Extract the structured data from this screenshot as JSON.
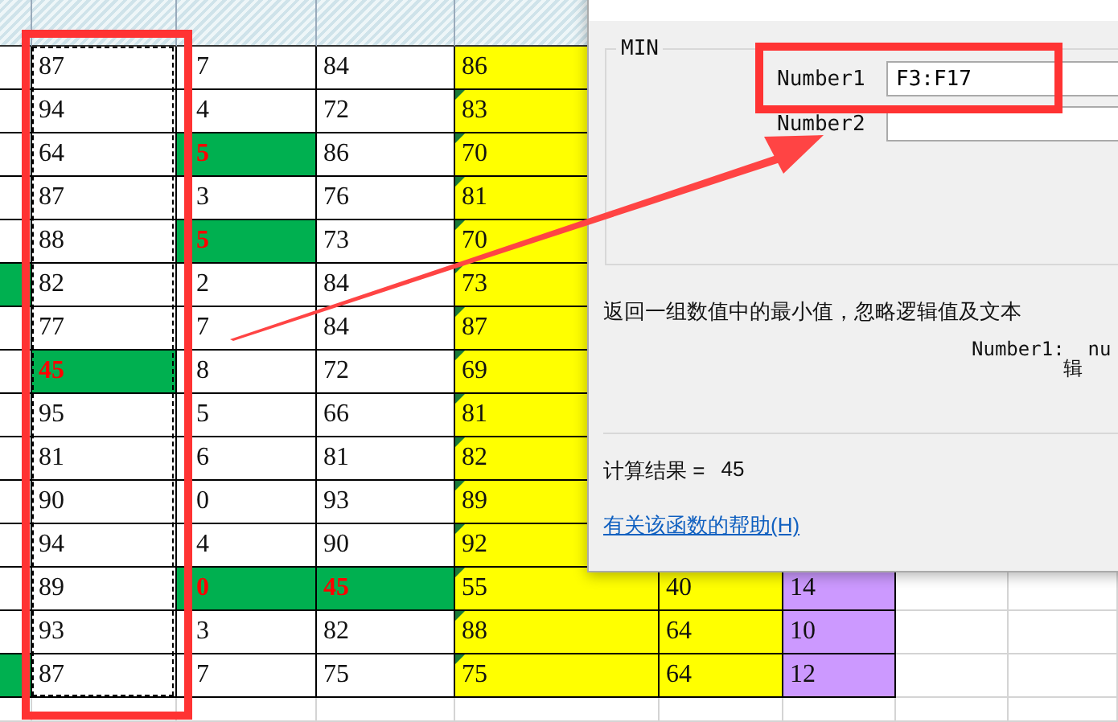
{
  "sheet": {
    "rows": [
      {
        "edge_highlight": false,
        "cells": [
          {
            "text": "87",
            "highlight": false
          },
          {
            "text": "7",
            "highlight": false
          },
          {
            "text": "84",
            "highlight": false
          },
          {
            "text": "86",
            "highlight": false,
            "flag": false
          }
        ]
      },
      {
        "edge_highlight": false,
        "cells": [
          {
            "text": "94",
            "highlight": false
          },
          {
            "text": "4",
            "highlight": false
          },
          {
            "text": "72",
            "highlight": false
          },
          {
            "text": "83",
            "highlight": false,
            "flag": true
          }
        ]
      },
      {
        "edge_highlight": false,
        "cells": [
          {
            "text": "64",
            "highlight": false
          },
          {
            "text": "5",
            "highlight": true
          },
          {
            "text": "86",
            "highlight": false
          },
          {
            "text": "70",
            "highlight": false,
            "flag": true
          }
        ]
      },
      {
        "edge_highlight": false,
        "cells": [
          {
            "text": "87",
            "highlight": false
          },
          {
            "text": "3",
            "highlight": false
          },
          {
            "text": "76",
            "highlight": false
          },
          {
            "text": "81",
            "highlight": false,
            "flag": true
          }
        ]
      },
      {
        "edge_highlight": false,
        "cells": [
          {
            "text": "88",
            "highlight": false
          },
          {
            "text": "5",
            "highlight": true
          },
          {
            "text": "73",
            "highlight": false
          },
          {
            "text": "70",
            "highlight": false,
            "flag": true
          }
        ]
      },
      {
        "edge_highlight": true,
        "cells": [
          {
            "text": "82",
            "highlight": false
          },
          {
            "text": "2",
            "highlight": false
          },
          {
            "text": "84",
            "highlight": false
          },
          {
            "text": "73",
            "highlight": false,
            "flag": true
          }
        ]
      },
      {
        "edge_highlight": false,
        "cells": [
          {
            "text": "77",
            "highlight": false
          },
          {
            "text": "7",
            "highlight": false
          },
          {
            "text": "84",
            "highlight": false
          },
          {
            "text": "87",
            "highlight": false,
            "flag": true
          }
        ]
      },
      {
        "edge_highlight": false,
        "cells": [
          {
            "text": "45",
            "highlight": true
          },
          {
            "text": "8",
            "highlight": false
          },
          {
            "text": "72",
            "highlight": false
          },
          {
            "text": "69",
            "highlight": false,
            "flag": true
          }
        ]
      },
      {
        "edge_highlight": false,
        "cells": [
          {
            "text": "95",
            "highlight": false
          },
          {
            "text": "5",
            "highlight": false
          },
          {
            "text": "66",
            "highlight": false
          },
          {
            "text": "81",
            "highlight": false,
            "flag": true
          }
        ]
      },
      {
        "edge_highlight": false,
        "cells": [
          {
            "text": "81",
            "highlight": false
          },
          {
            "text": "6",
            "highlight": false
          },
          {
            "text": "81",
            "highlight": false
          },
          {
            "text": "82",
            "highlight": false,
            "flag": true
          }
        ]
      },
      {
        "edge_highlight": false,
        "cells": [
          {
            "text": "90",
            "highlight": false
          },
          {
            "text": "0",
            "highlight": false
          },
          {
            "text": "93",
            "highlight": false
          },
          {
            "text": "89",
            "highlight": false,
            "flag": true
          }
        ]
      },
      {
        "edge_highlight": false,
        "cells": [
          {
            "text": "94",
            "highlight": false
          },
          {
            "text": "4",
            "highlight": false
          },
          {
            "text": "90",
            "highlight": false
          },
          {
            "text": "92",
            "highlight": false,
            "flag": true
          }
        ]
      },
      {
        "edge_highlight": false,
        "cells": [
          {
            "text": "89",
            "highlight": false
          },
          {
            "text": "0",
            "highlight": true
          },
          {
            "text": "45",
            "highlight": true
          },
          {
            "text": "55",
            "highlight": false,
            "flag": true
          },
          {
            "text": "40",
            "highlight": false
          },
          {
            "text": "14",
            "highlight": false
          }
        ]
      },
      {
        "edge_highlight": false,
        "cells": [
          {
            "text": "93",
            "highlight": false
          },
          {
            "text": "3",
            "highlight": false
          },
          {
            "text": "82",
            "highlight": false
          },
          {
            "text": "88",
            "highlight": false,
            "flag": true
          },
          {
            "text": "64",
            "highlight": false
          },
          {
            "text": "10",
            "highlight": false
          }
        ]
      },
      {
        "edge_highlight": true,
        "cells": [
          {
            "text": "87",
            "highlight": false
          },
          {
            "text": "7",
            "highlight": false
          },
          {
            "text": "75",
            "highlight": false
          },
          {
            "text": "75",
            "highlight": false,
            "flag": true
          },
          {
            "text": "64",
            "highlight": false
          },
          {
            "text": "12",
            "highlight": false
          }
        ]
      }
    ]
  },
  "dialog": {
    "group_title": "MIN",
    "arguments": [
      {
        "label": "Number1",
        "value": "F3:F17"
      },
      {
        "label": "Number2"
      }
    ],
    "description": "返回一组数值中的最小值，忽略逻辑值及文本",
    "argument_help": [
      "Number1:  nu",
      "辑"
    ],
    "result_label": "计算结果 =",
    "result_value": "45",
    "help_link": "有关该函数的帮助(H)"
  }
}
